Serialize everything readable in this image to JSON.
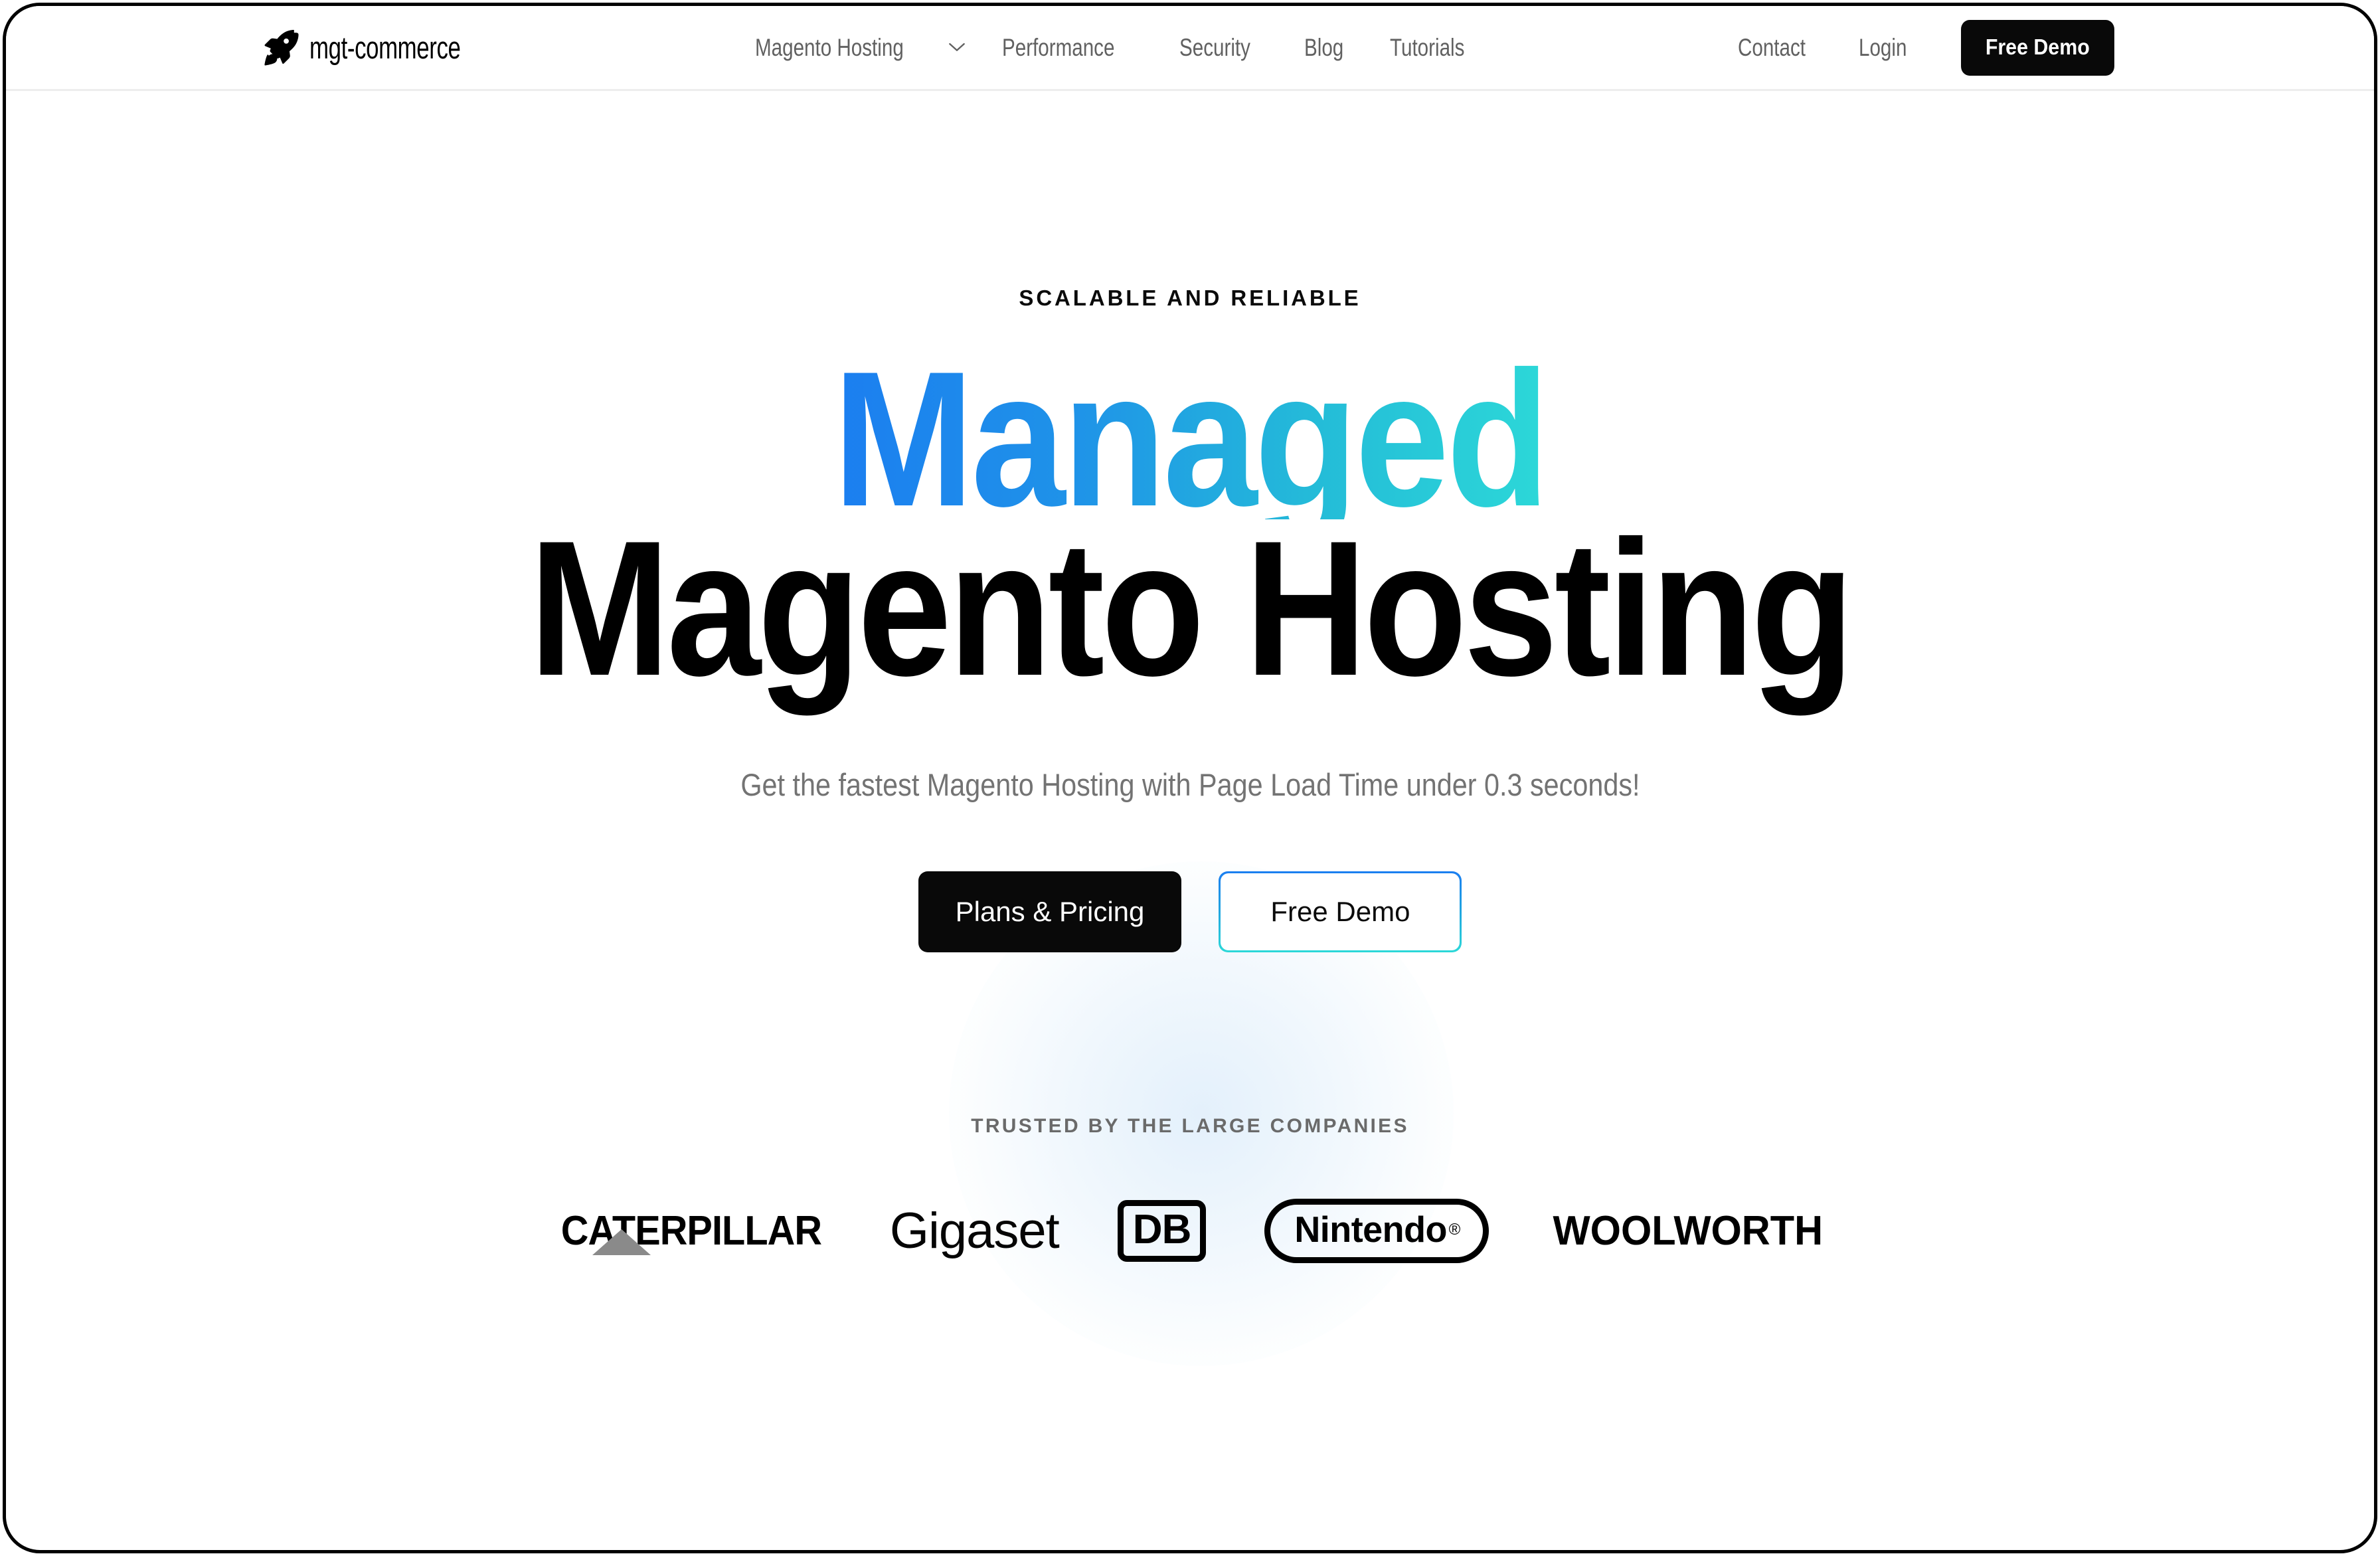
{
  "brand": {
    "name": "mgt-commerce",
    "icon": "rocket-icon"
  },
  "nav": {
    "items": [
      {
        "label": "Magento Hosting",
        "has_dropdown": true,
        "icon": "chevron-down-icon"
      },
      {
        "label": "Performance",
        "has_dropdown": false
      },
      {
        "label": "Security",
        "has_dropdown": false
      },
      {
        "label": "Blog",
        "has_dropdown": false
      },
      {
        "label": "Tutorials",
        "has_dropdown": false
      }
    ],
    "right": {
      "contact": "Contact",
      "login": "Login",
      "demo_button": "Free Demo"
    }
  },
  "hero": {
    "eyebrow": "SCALABLE AND RELIABLE",
    "headline_top": "Managed",
    "headline_bottom": "Magento Hosting",
    "subtitle": "Get the fastest Magento Hosting with Page Load Time under 0.3 seconds!",
    "cta_primary": "Plans & Pricing",
    "cta_secondary": "Free Demo"
  },
  "trusted": {
    "label": "TRUSTED BY THE LARGE COMPANIES",
    "logos": [
      {
        "name": "CATERPILLAR"
      },
      {
        "name": "Gigaset"
      },
      {
        "name": "DB"
      },
      {
        "name": "Nintendo",
        "suffix": "®"
      },
      {
        "name": "WOOLWORTH"
      }
    ]
  },
  "colors": {
    "gradient_start": "#1b7ef0",
    "gradient_end": "#2cd8d8",
    "text_primary": "#000000",
    "text_muted": "#737373",
    "button_dark": "#090909",
    "divider": "#ededed"
  }
}
